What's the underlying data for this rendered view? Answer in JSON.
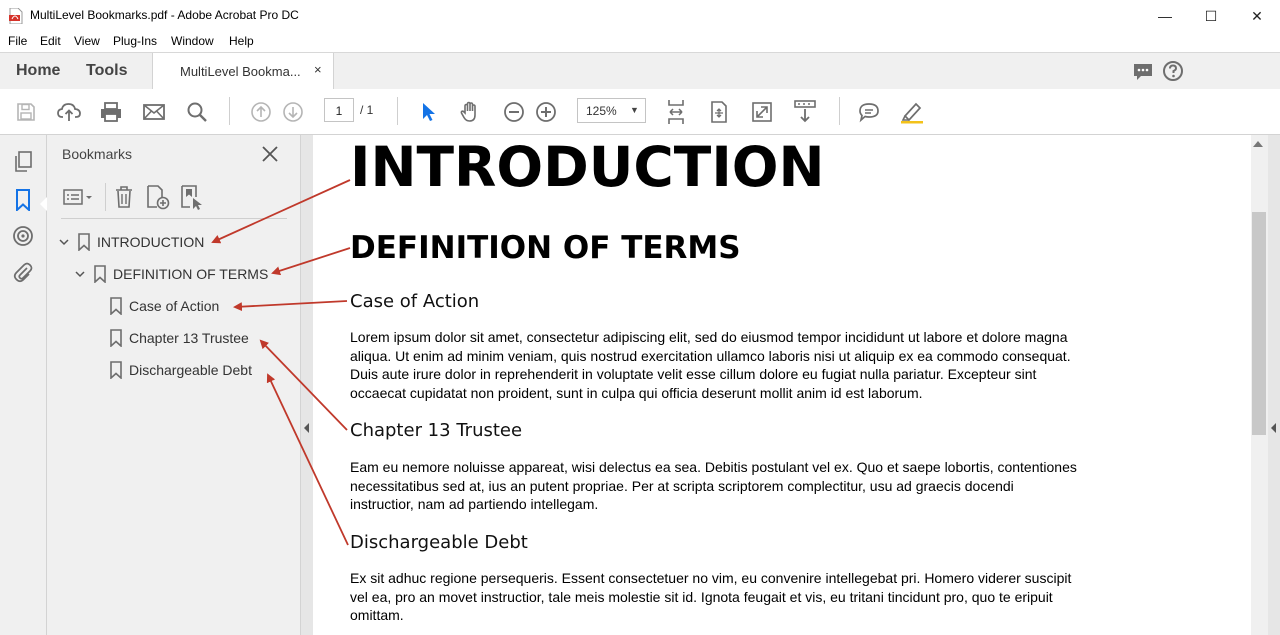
{
  "window": {
    "title": "MultiLevel Bookmarks.pdf - Adobe Acrobat Pro DC",
    "minimize": "—",
    "maximize": "☐",
    "close": "✕"
  },
  "menu": [
    "File",
    "Edit",
    "View",
    "Plug-Ins",
    "Window",
    "Help"
  ],
  "tabs": {
    "home": "Home",
    "tools": "Tools",
    "document": "MultiLevel Bookma...",
    "document_close": "×"
  },
  "toolbar": {
    "page_current": "1",
    "page_total": "/  1",
    "zoom": "125%",
    "zoom_caret": "▼"
  },
  "bookmarks": {
    "title": "Bookmarks",
    "items": [
      {
        "label": "INTRODUCTION"
      },
      {
        "label": "DEFINITION OF TERMS"
      },
      {
        "label": "Case of Action"
      },
      {
        "label": "Chapter 13 Trustee"
      },
      {
        "label": "Dischargeable Debt"
      }
    ]
  },
  "document": {
    "h1": "INTRODUCTION",
    "h2": "DEFINITION OF TERMS",
    "sections": [
      {
        "heading": "Case of Action",
        "lines": [
          "Lorem ipsum dolor sit amet, consectetur adipiscing elit, sed do eiusmod tempor incididunt ut labore et dolore magna",
          "aliqua. Ut enim ad minim veniam, quis nostrud exercitation ullamco laboris nisi ut aliquip ex ea commodo consequat.",
          "Duis aute irure dolor in reprehenderit in voluptate velit esse cillum dolore eu fugiat nulla pariatur. Excepteur sint",
          "occaecat cupidatat non proident, sunt in culpa qui officia deserunt mollit anim id est laborum."
        ]
      },
      {
        "heading": "Chapter 13 Trustee",
        "lines": [
          "Eam eu nemore noluisse appareat, wisi delectus ea sea. Debitis postulant vel ex. Quo et saepe lobortis, contentiones",
          "necessitatibus sed at, ius an putent propriae. Per at scripta scriptorem complectitur, usu ad graecis docendi",
          "instructior, nam ad partiendo intellegam."
        ]
      },
      {
        "heading": "Dischargeable Debt",
        "lines": [
          "Ex sit adhuc regione persequeris. Essent consectetuer no vim, eu convenire intellegebat pri. Homero viderer suscipit",
          "vel ea, pro an movet instructior, tale meis molestie sit id. Ignota feugait et vis, eu tritani tincidunt pro, quo te eripuit",
          "omittam."
        ]
      }
    ]
  },
  "colors": {
    "arrow": "#c0392b",
    "accent_blue": "#1473e6",
    "icon_gray": "#6e6e6e"
  }
}
